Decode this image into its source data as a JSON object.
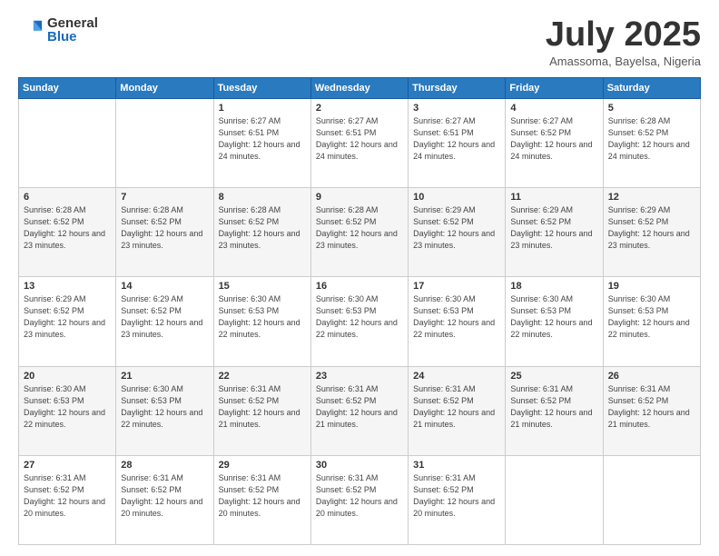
{
  "header": {
    "logo_general": "General",
    "logo_blue": "Blue",
    "month_title": "July 2025",
    "subtitle": "Amassoma, Bayelsa, Nigeria"
  },
  "days_of_week": [
    "Sunday",
    "Monday",
    "Tuesday",
    "Wednesday",
    "Thursday",
    "Friday",
    "Saturday"
  ],
  "weeks": [
    [
      {
        "day": "",
        "info": ""
      },
      {
        "day": "",
        "info": ""
      },
      {
        "day": "1",
        "info": "Sunrise: 6:27 AM\nSunset: 6:51 PM\nDaylight: 12 hours and 24 minutes."
      },
      {
        "day": "2",
        "info": "Sunrise: 6:27 AM\nSunset: 6:51 PM\nDaylight: 12 hours and 24 minutes."
      },
      {
        "day": "3",
        "info": "Sunrise: 6:27 AM\nSunset: 6:51 PM\nDaylight: 12 hours and 24 minutes."
      },
      {
        "day": "4",
        "info": "Sunrise: 6:27 AM\nSunset: 6:52 PM\nDaylight: 12 hours and 24 minutes."
      },
      {
        "day": "5",
        "info": "Sunrise: 6:28 AM\nSunset: 6:52 PM\nDaylight: 12 hours and 24 minutes."
      }
    ],
    [
      {
        "day": "6",
        "info": "Sunrise: 6:28 AM\nSunset: 6:52 PM\nDaylight: 12 hours and 23 minutes."
      },
      {
        "day": "7",
        "info": "Sunrise: 6:28 AM\nSunset: 6:52 PM\nDaylight: 12 hours and 23 minutes."
      },
      {
        "day": "8",
        "info": "Sunrise: 6:28 AM\nSunset: 6:52 PM\nDaylight: 12 hours and 23 minutes."
      },
      {
        "day": "9",
        "info": "Sunrise: 6:28 AM\nSunset: 6:52 PM\nDaylight: 12 hours and 23 minutes."
      },
      {
        "day": "10",
        "info": "Sunrise: 6:29 AM\nSunset: 6:52 PM\nDaylight: 12 hours and 23 minutes."
      },
      {
        "day": "11",
        "info": "Sunrise: 6:29 AM\nSunset: 6:52 PM\nDaylight: 12 hours and 23 minutes."
      },
      {
        "day": "12",
        "info": "Sunrise: 6:29 AM\nSunset: 6:52 PM\nDaylight: 12 hours and 23 minutes."
      }
    ],
    [
      {
        "day": "13",
        "info": "Sunrise: 6:29 AM\nSunset: 6:52 PM\nDaylight: 12 hours and 23 minutes."
      },
      {
        "day": "14",
        "info": "Sunrise: 6:29 AM\nSunset: 6:52 PM\nDaylight: 12 hours and 23 minutes."
      },
      {
        "day": "15",
        "info": "Sunrise: 6:30 AM\nSunset: 6:53 PM\nDaylight: 12 hours and 22 minutes."
      },
      {
        "day": "16",
        "info": "Sunrise: 6:30 AM\nSunset: 6:53 PM\nDaylight: 12 hours and 22 minutes."
      },
      {
        "day": "17",
        "info": "Sunrise: 6:30 AM\nSunset: 6:53 PM\nDaylight: 12 hours and 22 minutes."
      },
      {
        "day": "18",
        "info": "Sunrise: 6:30 AM\nSunset: 6:53 PM\nDaylight: 12 hours and 22 minutes."
      },
      {
        "day": "19",
        "info": "Sunrise: 6:30 AM\nSunset: 6:53 PM\nDaylight: 12 hours and 22 minutes."
      }
    ],
    [
      {
        "day": "20",
        "info": "Sunrise: 6:30 AM\nSunset: 6:53 PM\nDaylight: 12 hours and 22 minutes."
      },
      {
        "day": "21",
        "info": "Sunrise: 6:30 AM\nSunset: 6:53 PM\nDaylight: 12 hours and 22 minutes."
      },
      {
        "day": "22",
        "info": "Sunrise: 6:31 AM\nSunset: 6:52 PM\nDaylight: 12 hours and 21 minutes."
      },
      {
        "day": "23",
        "info": "Sunrise: 6:31 AM\nSunset: 6:52 PM\nDaylight: 12 hours and 21 minutes."
      },
      {
        "day": "24",
        "info": "Sunrise: 6:31 AM\nSunset: 6:52 PM\nDaylight: 12 hours and 21 minutes."
      },
      {
        "day": "25",
        "info": "Sunrise: 6:31 AM\nSunset: 6:52 PM\nDaylight: 12 hours and 21 minutes."
      },
      {
        "day": "26",
        "info": "Sunrise: 6:31 AM\nSunset: 6:52 PM\nDaylight: 12 hours and 21 minutes."
      }
    ],
    [
      {
        "day": "27",
        "info": "Sunrise: 6:31 AM\nSunset: 6:52 PM\nDaylight: 12 hours and 20 minutes."
      },
      {
        "day": "28",
        "info": "Sunrise: 6:31 AM\nSunset: 6:52 PM\nDaylight: 12 hours and 20 minutes."
      },
      {
        "day": "29",
        "info": "Sunrise: 6:31 AM\nSunset: 6:52 PM\nDaylight: 12 hours and 20 minutes."
      },
      {
        "day": "30",
        "info": "Sunrise: 6:31 AM\nSunset: 6:52 PM\nDaylight: 12 hours and 20 minutes."
      },
      {
        "day": "31",
        "info": "Sunrise: 6:31 AM\nSunset: 6:52 PM\nDaylight: 12 hours and 20 minutes."
      },
      {
        "day": "",
        "info": ""
      },
      {
        "day": "",
        "info": ""
      }
    ]
  ]
}
